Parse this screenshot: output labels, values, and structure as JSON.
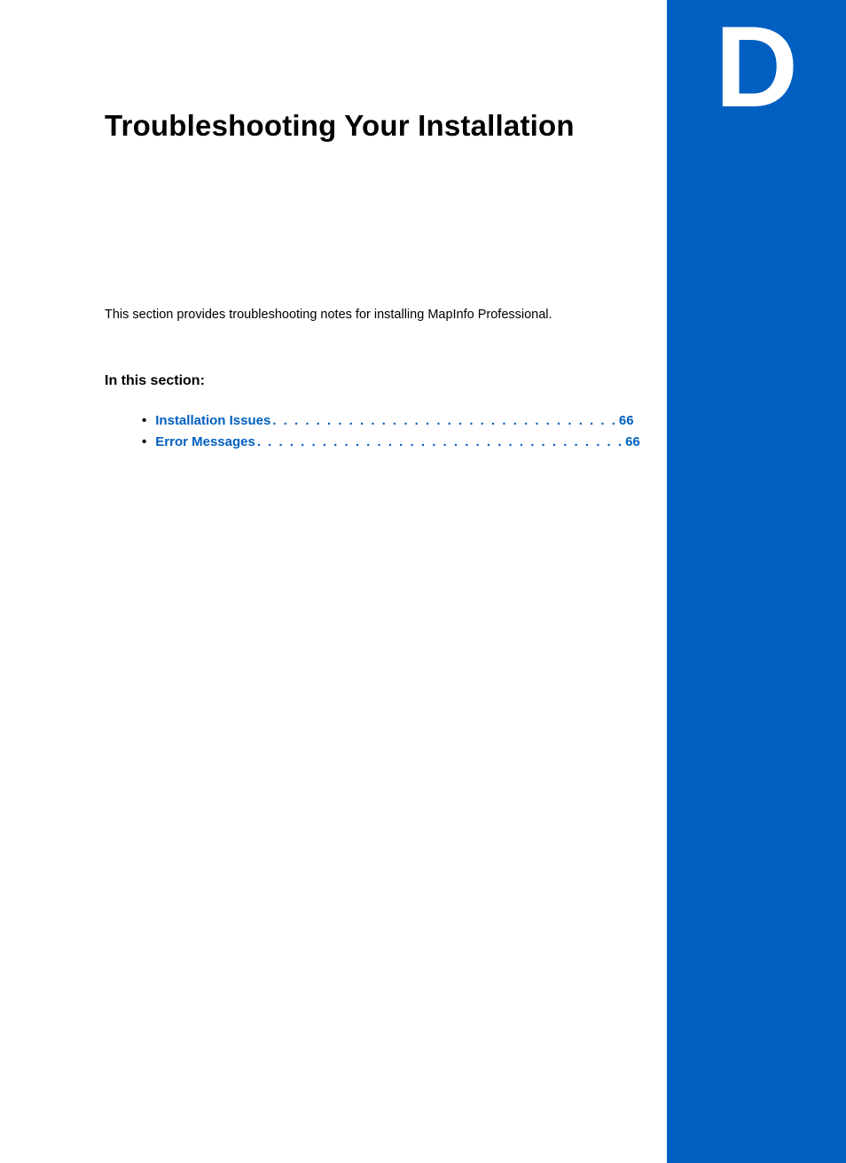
{
  "appendix_letter": "D",
  "title": "Troubleshooting Your Installation",
  "intro": "This section provides troubleshooting notes for installing MapInfo Professional.",
  "section_label": "In this section:",
  "toc": [
    {
      "label": "Installation Issues",
      "dots": " . . . . . . . . . . . . . . . . . . . . . . . . . . . . . . . .",
      "page": "66"
    },
    {
      "label": "Error Messages",
      "dots": " . . . . . . . . . . . . . . . . . . . . . . . . . . . . . . . . . .",
      "page": "66"
    }
  ]
}
